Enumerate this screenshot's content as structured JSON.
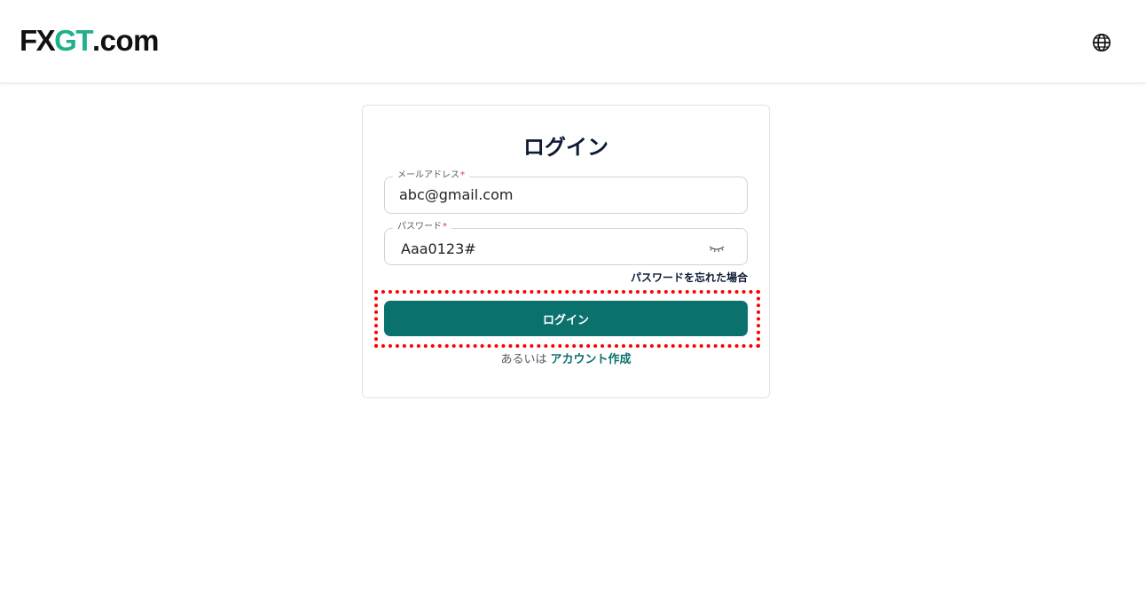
{
  "header": {
    "logo": {
      "part1": "FX",
      "part2": "GT",
      "part3": ".com"
    },
    "language_icon": "globe-icon"
  },
  "login": {
    "title": "ログイン",
    "email": {
      "label": "メールアドレス",
      "required": "*",
      "value": "abc@gmail.com"
    },
    "password": {
      "label": "パスワード",
      "required": "*",
      "value": "Aaa0123#",
      "toggle_icon": "eye-closed-icon"
    },
    "forgot_password": "パスワードを忘れた場合",
    "submit_label": "ログイン",
    "alt_text": "あるいは",
    "create_account": "アカウント作成"
  },
  "colors": {
    "brand_teal": "#0b716d",
    "logo_green": "#1fb08c",
    "highlight_red": "#ff0000"
  }
}
